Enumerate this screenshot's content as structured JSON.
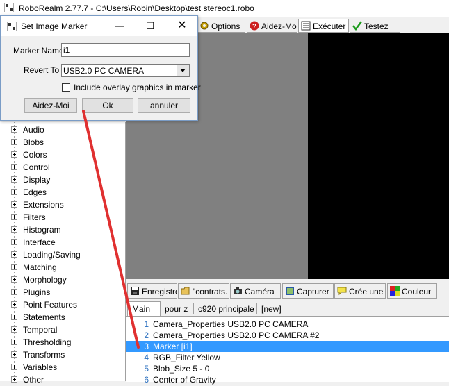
{
  "main_window": {
    "title": "RoboRealm 2.77.7 - C:\\Users\\Robin\\Desktop\\test stereoc1.robo"
  },
  "toolbar": {
    "options_label": "Options",
    "aidez_label": "Aidez-Mo",
    "executer_label": "Exécuter",
    "testez_label": "Testez"
  },
  "dialog": {
    "title": "Set Image Marker",
    "marker_name_label": "Marker Name",
    "marker_name_value": "i1",
    "revert_to_label": "Revert To",
    "revert_to_value": "USB2.0 PC CAMERA",
    "overlay_label": "Include overlay graphics in marker",
    "help_button": "Aidez-Moi",
    "ok_button": "Ok",
    "cancel_button": "annuler",
    "minimize_glyph": "—",
    "maximize_glyph": "☐",
    "close_glyph": "✕"
  },
  "tree": {
    "items": [
      {
        "label": "Audio"
      },
      {
        "label": "Blobs"
      },
      {
        "label": "Colors"
      },
      {
        "label": "Control"
      },
      {
        "label": "Display"
      },
      {
        "label": "Edges"
      },
      {
        "label": "Extensions"
      },
      {
        "label": "Filters"
      },
      {
        "label": "Histogram"
      },
      {
        "label": "Interface"
      },
      {
        "label": "Loading/Saving"
      },
      {
        "label": "Matching"
      },
      {
        "label": "Morphology"
      },
      {
        "label": "Plugins"
      },
      {
        "label": "Point Features"
      },
      {
        "label": "Statements"
      },
      {
        "label": "Temporal"
      },
      {
        "label": "Thresholding"
      },
      {
        "label": "Transforms"
      },
      {
        "label": "Variables"
      },
      {
        "label": "Other"
      }
    ]
  },
  "bottom_toolbar": {
    "enregistrer_label": "Enregistrer",
    "contrats_label": "\"contrats.",
    "camera_label": "Caméra",
    "capturer_label": "Capturer",
    "creer_label": "Crée une",
    "couleur_label": "Couleur"
  },
  "tabs": [
    {
      "label": "Main"
    },
    {
      "label": "pour z"
    },
    {
      "label": "c920 principale"
    },
    {
      "label": "[new]"
    }
  ],
  "pipeline": {
    "rows": [
      {
        "num": "1",
        "label": "Camera_Properties USB2.0 PC CAMERA"
      },
      {
        "num": "2",
        "label": "Camera_Properties USB2.0 PC CAMERA #2"
      },
      {
        "num": "3",
        "label": "Marker [i1]"
      },
      {
        "num": "4",
        "label": "RGB_Filter Yellow"
      },
      {
        "num": "5",
        "label": "Blob_Size 5 - 0"
      },
      {
        "num": "6",
        "label": "Center of Gravity"
      }
    ],
    "selected_index": 2
  },
  "colors": {
    "selection": "#3399ff",
    "annotation_arrow": "#e03030",
    "video_gray": "#808080",
    "video_black": "#000000"
  }
}
